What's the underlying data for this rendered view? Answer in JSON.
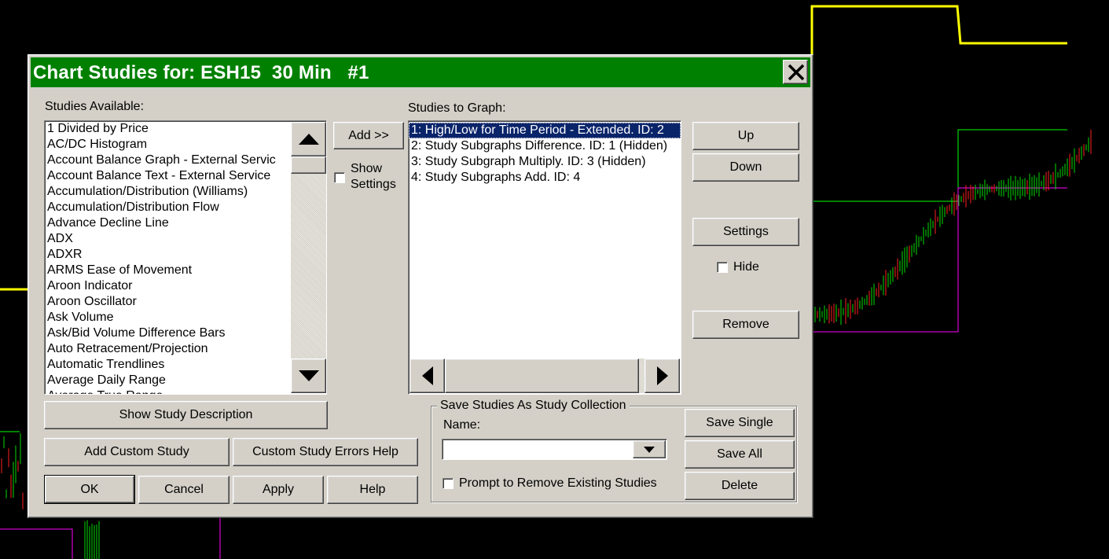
{
  "dialog": {
    "title": "Chart Studies for: ESH15  30 Min   #1",
    "close_label": "X"
  },
  "available": {
    "label": "Studies Available:",
    "items": [
      "1 Divided by Price",
      "AC/DC Histogram",
      "Account Balance Graph - External Servic",
      "Account Balance Text - External Service",
      "Accumulation/Distribution (Williams)",
      "Accumulation/Distribution Flow",
      "Advance Decline Line",
      "ADX",
      "ADXR",
      "ARMS Ease of Movement",
      "Aroon Indicator",
      "Aroon Oscillator",
      "Ask Volume",
      "Ask/Bid Volume Difference Bars",
      "Auto Retracement/Projection",
      "Automatic Trendlines",
      "Average Daily Range",
      "Average True Range"
    ]
  },
  "add": {
    "add_label": "Add >>",
    "show_settings_line1": "Show",
    "show_settings_line2": "Settings"
  },
  "graph": {
    "label": "Studies to Graph:",
    "items": [
      "1: High/Low for Time Period - Extended. ID: 2",
      "2: Study Subgraphs Difference. ID: 1 (Hidden)",
      "3: Study Subgraph Multiply. ID: 3 (Hidden)",
      "4: Study Subgraphs Add. ID: 4"
    ]
  },
  "right_buttons": {
    "up": "Up",
    "down": "Down",
    "settings": "Settings",
    "hide": "Hide",
    "remove": "Remove"
  },
  "lower_buttons": {
    "show_description": "Show Study Description",
    "add_custom": "Add Custom Study",
    "custom_errors": "Custom Study Errors Help",
    "ok": "OK",
    "cancel": "Cancel",
    "apply": "Apply",
    "help": "Help"
  },
  "collection": {
    "group_label": "Save Studies As Study Collection",
    "name_label": "Name:",
    "name_value": "",
    "prompt_label": "Prompt to Remove Existing Studies",
    "save_single": "Save Single",
    "save_all": "Save All",
    "delete": "Delete"
  },
  "colors": {
    "title_bar": "#008000",
    "background_chart": "#000000",
    "selection": "#0a246a"
  }
}
